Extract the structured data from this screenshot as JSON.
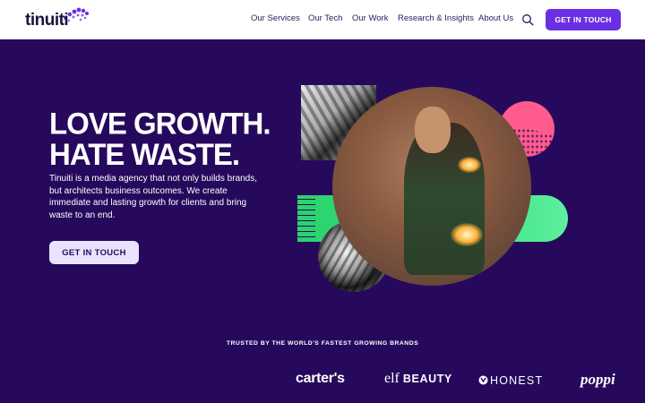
{
  "header": {
    "logo_text": "tinuiti",
    "nav": [
      "Our Services",
      "Our Tech",
      "Our Work",
      "Research & Insights",
      "About Us"
    ],
    "search_icon": "search-icon",
    "cta_label": "GET IN TOUCH"
  },
  "hero": {
    "title_line1": "LOVE GROWTH.",
    "title_line2": "HATE WASTE.",
    "description": "Tinuiti is a media agency that not only builds brands, but architects business outcomes. We create immediate and lasting growth for clients and bring waste to an end.",
    "cta_label": "GET IN TOUCH"
  },
  "brands": {
    "heading": "TRUSTED BY THE WORLD'S FASTEST GROWING BRANDS",
    "logos": [
      "carter's",
      "elf",
      "BEAUTY",
      "HONEST",
      "poppi"
    ]
  },
  "colors": {
    "background": "#26095c",
    "accent": "#6a2fe3",
    "pink": "#ff5b8c",
    "green": "#2bd36e"
  }
}
